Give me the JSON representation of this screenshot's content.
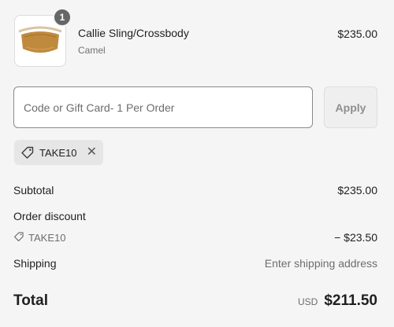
{
  "product": {
    "quantity": "1",
    "name": "Callie Sling/Crossbody",
    "variant": "Camel",
    "price": "$235.00",
    "image_color": "#c08a3e"
  },
  "discount_form": {
    "placeholder": "Code or Gift Card- 1 Per Order",
    "apply_label": "Apply"
  },
  "applied_code": {
    "icon": "tag-icon",
    "code": "TAKE10",
    "remove_icon": "close-icon"
  },
  "summary": {
    "subtotal_label": "Subtotal",
    "subtotal_value": "$235.00",
    "discount_label": "Order discount",
    "discount_code": "TAKE10",
    "discount_value": "− $23.50",
    "shipping_label": "Shipping",
    "shipping_value": "Enter shipping address",
    "total_label": "Total",
    "total_currency": "USD",
    "total_value": "$211.50"
  }
}
